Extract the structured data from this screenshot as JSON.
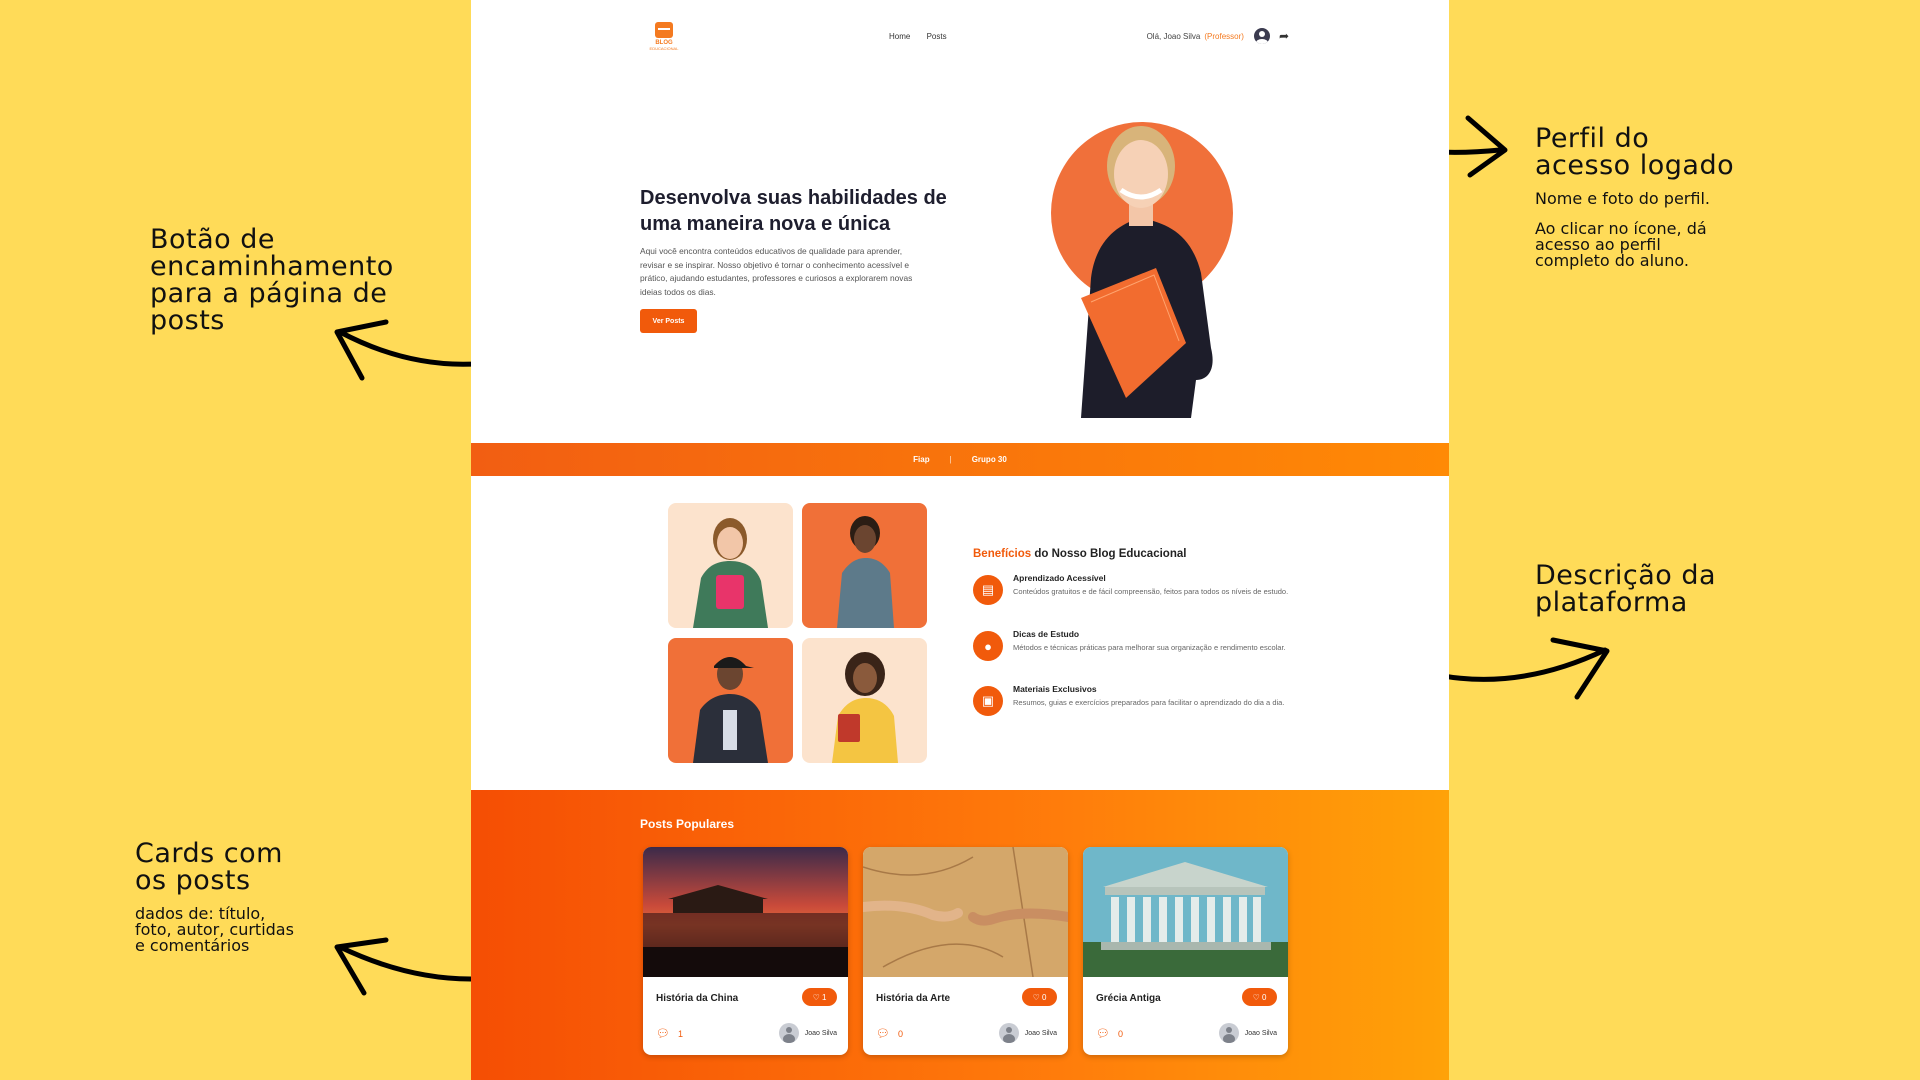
{
  "annotations": {
    "perfil": {
      "title": [
        "Perfil do",
        "acesso logado"
      ],
      "body": [
        "Nome e foto do perfil.",
        "Ao clicar no ícone, dá acesso ao perfil completo do aluno."
      ]
    },
    "botao": {
      "title": [
        "Botão de",
        "encaminhamento",
        "para a página de",
        "posts"
      ]
    },
    "descricao": {
      "title": [
        "Descrição da",
        "plataforma"
      ]
    },
    "cards": {
      "title": [
        "Cards com",
        "os posts"
      ],
      "body": [
        "dados de: título, foto, autor, curtidas e comentários"
      ]
    }
  },
  "header": {
    "logo_text": "BLOG",
    "logo_sub": "EDUCACIONAL",
    "nav": [
      "Home",
      "Posts"
    ],
    "greeting": "Olá, Joao Silva",
    "role": "(Professor)"
  },
  "hero": {
    "title": "Desenvolva suas habilidades de uma maneira nova e única",
    "text": "Aqui você encontra conteúdos educativos de qualidade para aprender, revisar e se inspirar. Nosso objetivo é tornar o conhecimento acessível e prático, ajudando estudantes, professores e curiosos a explorarem novas ideias todos os dias.",
    "button": "Ver Posts"
  },
  "strip": {
    "left": "Fiap",
    "separator": "|",
    "right": "Grupo 30"
  },
  "benefits": {
    "title_highlight": "Benefícios",
    "title_rest": " do Nosso Blog Educacional",
    "items": [
      {
        "title": "Aprendizado Acessível",
        "desc": "Conteúdos gratuitos e de fácil compreensão, feitos para todos os níveis de estudo.",
        "icon": "book-icon"
      },
      {
        "title": "Dicas de Estudo",
        "desc": "Métodos e técnicas práticas para melhorar sua organização e rendimento escolar.",
        "icon": "lightbulb-icon"
      },
      {
        "title": "Materiais Exclusivos",
        "desc": "Resumos, guias e exercícios preparados para facilitar o aprendizado do dia a dia.",
        "icon": "teacher-icon"
      }
    ]
  },
  "posts": {
    "title": "Posts Populares",
    "cards": [
      {
        "title": "História da China",
        "likes": "1",
        "comments": "1",
        "author": "Joao Silva"
      },
      {
        "title": "História da Arte",
        "likes": "0",
        "comments": "0",
        "author": "Joao Silva"
      },
      {
        "title": "Grécia Antiga",
        "likes": "0",
        "comments": "0",
        "author": "Joao Silva"
      }
    ]
  },
  "colors": {
    "accent": "#F15A0B",
    "background": "#FFDB58"
  }
}
